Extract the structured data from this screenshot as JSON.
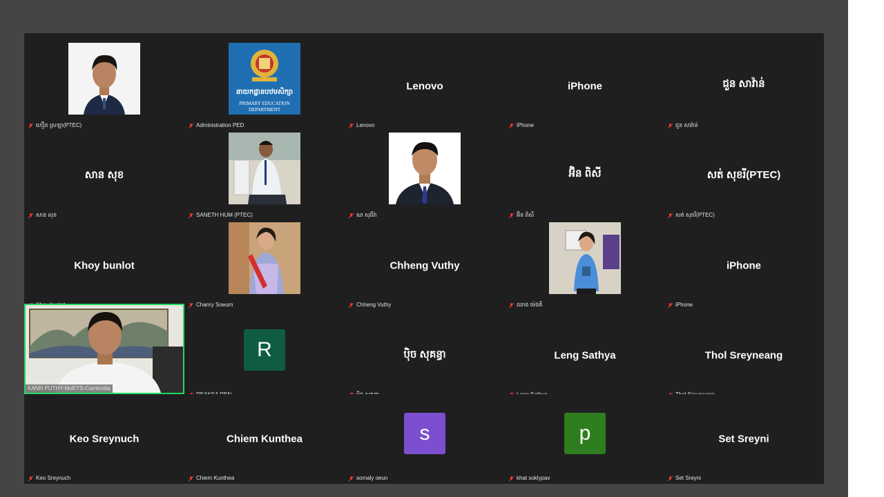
{
  "participants": [
    {
      "tag": "ហឿន ស្រឡា(PTEC)",
      "display": "",
      "type": "photo",
      "photo": "student-portrait"
    },
    {
      "tag": "Administration PED",
      "display": "",
      "type": "logo",
      "logo_text_kh": "នាយកដ្ឋានបឋមសិក្សា",
      "logo_text_en1": "PRIMARY EDUCATION",
      "logo_text_en2": "DEPARTMENT"
    },
    {
      "tag": "Lenovo",
      "display": "Lenovo",
      "type": "name"
    },
    {
      "tag": "iPhone",
      "display": "iPhone",
      "type": "name"
    },
    {
      "tag": "ជួន សាវ៉ាន់",
      "display": "ជួន សាវ៉ាន់",
      "type": "name"
    },
    {
      "tag": "សាន សុខ",
      "display": "សាន សុខ",
      "type": "name"
    },
    {
      "tag": "SANETH HUM (PTEC)",
      "display": "",
      "type": "photo",
      "photo": "seated-portrait"
    },
    {
      "tag": "ណ សុធីរ៉ា",
      "display": "",
      "type": "photo",
      "photo": "formal-portrait"
    },
    {
      "tag": "អ៊ិន ពិសី",
      "display": "អ៊ិន ពិសី",
      "type": "name"
    },
    {
      "tag": "សត់ សុខរី(PTEC)",
      "display": "សត់ សុខរី(PTEC)",
      "type": "name"
    },
    {
      "tag": "Khoy bunlot",
      "display": "Khoy bunlot",
      "type": "name"
    },
    {
      "tag": "Chanry Soeum",
      "display": "",
      "type": "photo",
      "photo": "woman-scarf"
    },
    {
      "tag": "Chheng Vuthy",
      "display": "Chheng Vuthy",
      "type": "name"
    },
    {
      "tag": "ឈាង ម៉េងគី",
      "display": "",
      "type": "photo",
      "photo": "teacher-standing"
    },
    {
      "tag": "iPhone",
      "display": "iPhone",
      "type": "name"
    },
    {
      "tag": "KANN PUTHY-MoEYS-Cambodia",
      "display": "",
      "type": "video"
    },
    {
      "tag": "REAKSA REN",
      "display": "",
      "type": "letter",
      "letter": "R",
      "color": "#0f5c43"
    },
    {
      "tag": "ប៉ិច សុគន្ធា",
      "display": "ប៉ិច សុគន្ធា",
      "type": "name"
    },
    {
      "tag": "Leng Sathya",
      "display": "Leng Sathya",
      "type": "name"
    },
    {
      "tag": "Thol Sreyneang",
      "display": "Thol Sreyneang",
      "type": "name"
    },
    {
      "tag": "Keo Sreynuch",
      "display": "Keo Sreynuch",
      "type": "name"
    },
    {
      "tag": "Chiem Kunthea",
      "display": "Chiem Kunthea",
      "type": "name"
    },
    {
      "tag": "somaly oeun",
      "display": "",
      "type": "letter",
      "letter": "s",
      "color": "#7b4fcf"
    },
    {
      "tag": "khat soklypav",
      "display": "",
      "type": "letter",
      "letter": "p",
      "color": "#2e7d1f"
    },
    {
      "tag": "Set Sreyni",
      "display": "Set Sreyni",
      "type": "name"
    }
  ],
  "colors": {
    "active_speaker_border": "#23d962",
    "mute_icon": "#e53935",
    "tile_background": "#1f1f1f"
  },
  "icons": {
    "mute": "muted-microphone-icon"
  }
}
